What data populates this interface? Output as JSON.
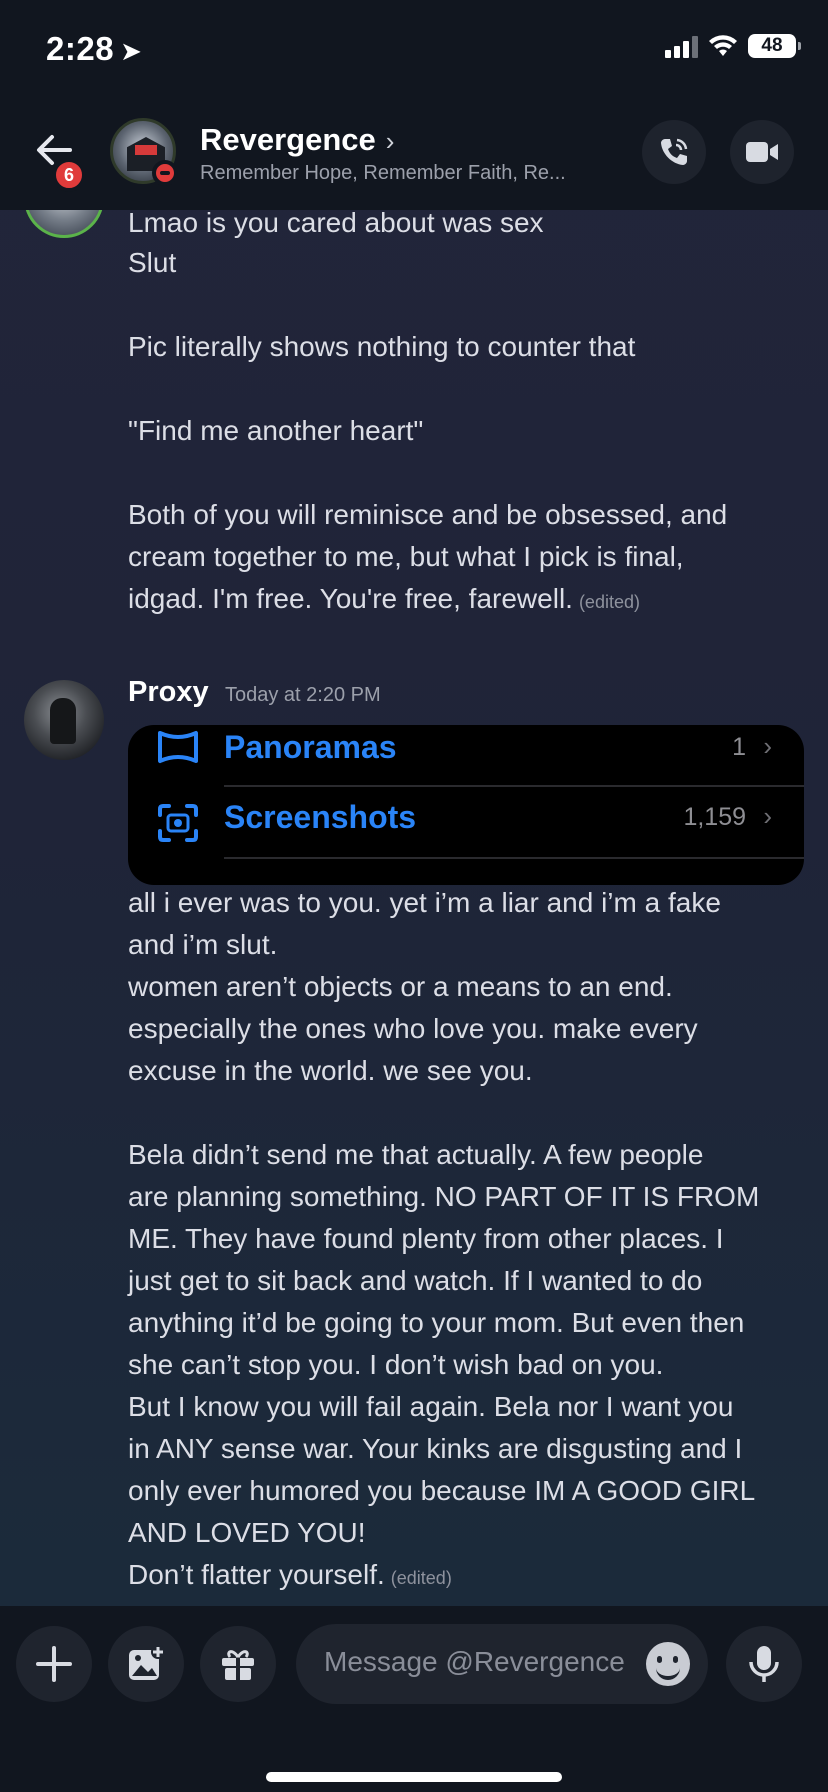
{
  "status_bar": {
    "time": "2:28",
    "battery": "48"
  },
  "header": {
    "back_badge": "6",
    "name": "Revergence",
    "subtitle": "Remember Hope, Remember Faith, Re..."
  },
  "messages": {
    "first_group": [
      "Lmao is you cared about was sex",
      "Slut",
      "Pic literally shows nothing to counter that",
      "\"Find me another heart\"",
      "Both of you will reminisce and be obsessed, and",
      "cream together to me, but what I pick is final,",
      "idgad. I'm free. You're free, farewell."
    ],
    "first_group_edited": "(edited)",
    "proxy": {
      "author": "Proxy",
      "timestamp": "Today at 2:20 PM",
      "screenshot": {
        "rows": [
          {
            "label": "Panoramas",
            "count": "1"
          },
          {
            "label": "Screenshots",
            "count": "1,159"
          }
        ]
      },
      "lines": [
        "all i ever was to you. yet i’m a liar and i’m a fake",
        "and i’m slut.",
        "women aren’t objects or a means to an end.",
        "especially the ones who love you. make every",
        "excuse in the world. we see you.",
        "Bela didn’t send me that actually. A few people",
        "are planning something. NO PART OF IT IS FROM",
        "ME. They have found plenty from other places. I",
        "just get to sit back and watch. If I wanted to do",
        "anything it’d be going to your mom. But even then",
        "she can’t stop you. I don’t wish bad on you.",
        "But I know you will fail again. Bela nor I want you",
        "in ANY sense war. Your kinks are disgusting and I",
        "only ever humored you because IM A GOOD GIRL",
        "AND LOVED YOU!",
        "Don’t flatter yourself."
      ],
      "edited": "(edited)"
    }
  },
  "composer": {
    "placeholder": "Message @Revergence"
  }
}
